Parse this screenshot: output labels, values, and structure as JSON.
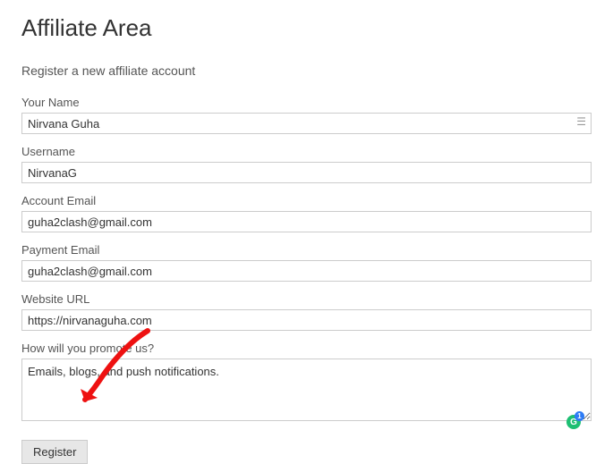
{
  "heading": "Affiliate Area",
  "subtitle": "Register a new affiliate account",
  "fields": {
    "name": {
      "label": "Your Name",
      "value": "Nirvana Guha"
    },
    "username": {
      "label": "Username",
      "value": "NirvanaG"
    },
    "account_email": {
      "label": "Account Email",
      "value": "guha2clash@gmail.com"
    },
    "payment_email": {
      "label": "Payment Email",
      "value": "guha2clash@gmail.com"
    },
    "website_url": {
      "label": "Website URL",
      "value": "https://nirvanaguha.com"
    },
    "promote": {
      "label": "How will you promote us?",
      "value": "Emails, blogs, and push notifications."
    }
  },
  "register_label": "Register",
  "grammarly_badge": "1",
  "grammarly_letter": "G"
}
